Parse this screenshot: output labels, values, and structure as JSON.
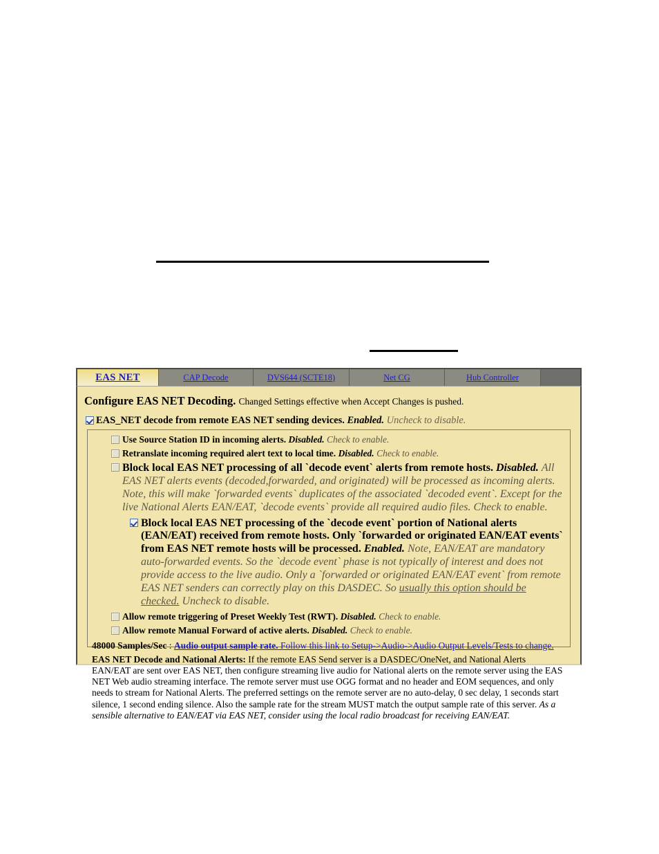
{
  "rules": {
    "top_divider": "horizontal-rule",
    "mid_divider": "horizontal-rule"
  },
  "tabs": [
    {
      "id": "eas-net",
      "label": "EAS NET",
      "active": true
    },
    {
      "id": "cap-decode",
      "label": "CAP Decode",
      "active": false
    },
    {
      "id": "dvs644",
      "label": "DVS644 (SCTE18)",
      "active": false
    },
    {
      "id": "net-cg",
      "label": "Net CG",
      "active": false
    },
    {
      "id": "hub",
      "label": "Hub Controller",
      "active": false
    }
  ],
  "panel": {
    "title": "Configure EAS NET Decoding.",
    "subtitle": "Changed Settings effective when Accept Changes is pushed."
  },
  "master_option": {
    "checked": true,
    "label": "EAS_NET decode from remote EAS NET sending devices.",
    "state": "Enabled.",
    "hint": "Uncheck to disable."
  },
  "options": [
    {
      "id": "source-station-id",
      "checked": false,
      "label": "Use Source Station ID in incoming alerts.",
      "state": "Disabled.",
      "hint": "Check to enable.",
      "detail": ""
    },
    {
      "id": "retranslate-local-time",
      "checked": false,
      "label": "Retranslate incoming required alert text to local time.",
      "state": "Disabled.",
      "hint": "Check to enable.",
      "detail": ""
    },
    {
      "id": "block-all-decode-events",
      "checked": false,
      "label": "Block local EAS NET processing of all `decode event` alerts from remote hosts.",
      "state": "Disabled.",
      "detail": "All EAS NET alerts events (decoded,forwarded, and originated) will be processed as incoming alerts. Note, this will make `forwarded events` duplicates of the associated `decoded event`. Except for the live National Alerts EAN/EAT, `decode events` provide all required audio files.",
      "hint": "Check to enable."
    },
    {
      "id": "block-national-decode-events",
      "checked": true,
      "label": "Block local EAS NET processing of the `decode event` portion of National alerts (EAN/EAT) received from remote hosts. Only `forwarded or originated EAN/EAT events` from EAS NET remote hosts will be processed.",
      "state": "Enabled.",
      "detail": "Note, EAN/EAT are mandatory auto-forwarded events. So the `decode event` phase is not typically of interest and does not provide access to the live audio. Only a `forwarded or originated EAN/EAT event` from remote EAS NET senders can correctly play on this DASDEC. So ",
      "detail_emphasis": "usually this option should be checked.",
      "hint": "Uncheck to disable."
    },
    {
      "id": "allow-remote-rwt",
      "checked": false,
      "label": "Allow remote triggering of Preset Weekly Test (RWT).",
      "state": "Disabled.",
      "hint": "Check to enable.",
      "detail": ""
    },
    {
      "id": "allow-remote-manual-forward",
      "checked": false,
      "label": "Allow remote Manual Forward of active alerts.",
      "state": "Disabled.",
      "hint": "Check to enable.",
      "detail": ""
    }
  ],
  "sample_rate": {
    "value": "48000 Samples/Sec",
    "separator": " : ",
    "link_bold": "Audio output sample rate.",
    "link_rest": " Follow this link to Setup->Audio->Audio Output Levels/Tests to change."
  },
  "national_alerts": {
    "heading": "EAS NET Decode and National Alerts:",
    "body": " If the remote EAS Send server is a DASDEC/OneNet, and National Alerts EAN/EAT are sent over EAS NET, then configure streaming live audio for National alerts on the remote server using the EAS NET Web audio streaming interface. The remote server must use OGG format and no header and EOM sequences, and only needs to stream for National Alerts. The preferred settings on the remote server are no auto-delay, 0 sec delay, 1 seconds start silence, 1 second ending silence. Also the sample rate for the stream MUST match the output sample rate of this server. ",
    "emphasis": "As a sensible alternative to EAN/EAT via EAS NET, consider using the local radio broadcast for receiving EAN/EAT."
  },
  "colors": {
    "panel_background": "#f1e4ad",
    "tab_inactive": "#8b8b81",
    "tab_active_top": "#efdd85",
    "link": "#1a1ac0",
    "border_dark": "#4a4a46"
  }
}
